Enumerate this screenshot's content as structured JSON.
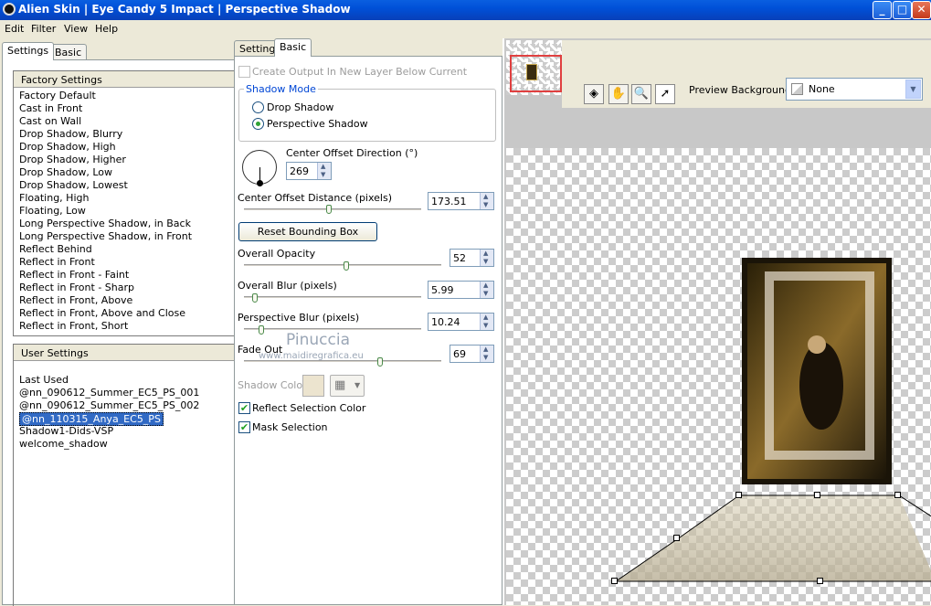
{
  "window": {
    "title": "Alien Skin | Eye Candy 5 Impact | Perspective Shadow",
    "min": "_",
    "max": "□",
    "close": "✕"
  },
  "menu": [
    "Edit",
    "Filter",
    "View",
    "Help"
  ],
  "left_tabs": [
    "Settings",
    "Basic"
  ],
  "factory": {
    "header": "Factory Settings",
    "items": [
      "Factory Default",
      "Cast in Front",
      "Cast on Wall",
      "Drop Shadow, Blurry",
      "Drop Shadow, High",
      "Drop Shadow, Higher",
      "Drop Shadow, Low",
      "Drop Shadow, Lowest",
      "Floating, High",
      "Floating, Low",
      "Long Perspective Shadow, in Back",
      "Long Perspective Shadow, in Front",
      "Reflect Behind",
      "Reflect in Front",
      "Reflect in Front - Faint",
      "Reflect in Front - Sharp",
      "Reflect in Front, Above",
      "Reflect in Front, Above and Close",
      "Reflect in Front, Short"
    ]
  },
  "user": {
    "header": "User Settings",
    "items": [
      "Last Used",
      "@nn_090612_Summer_EC5_PS_001",
      "@nn_090612_Summer_EC5_PS_002",
      "@nn_110315_Anya_EC5_PS",
      "Shadow1-Dids-VSP",
      "welcome_shadow"
    ],
    "selected_index": 3
  },
  "mid_tabs": [
    "Settings",
    "Basic"
  ],
  "basic": {
    "create_output": "Create Output In New Layer Below Current",
    "shadow_mode_label": "Shadow Mode",
    "modes": [
      "Drop Shadow",
      "Perspective Shadow"
    ],
    "selected_mode": 1,
    "direction_label": "Center Offset Direction (°)",
    "direction_value": "269",
    "distance_label": "Center Offset Distance (pixels)",
    "distance_value": "173.51",
    "reset_button": "Reset Bounding Box",
    "opacity_label": "Overall Opacity",
    "opacity_value": "52",
    "blur_label": "Overall Blur (pixels)",
    "blur_value": "5.99",
    "pblur_label": "Perspective Blur (pixels)",
    "pblur_value": "10.24",
    "fade_label": "Fade Out",
    "fade_value": "69",
    "shadow_color_label": "Shadow Color",
    "reflect_label": "Reflect Selection Color",
    "mask_label": "Mask Selection"
  },
  "slider_levels": {
    "distance": 0.48,
    "opacity": 0.52,
    "blur": 0.06,
    "pblur": 0.1,
    "fade": 0.69
  },
  "watermark": {
    "name": "Pinuccia",
    "url": "www.maidiregrafica.eu"
  },
  "preview": {
    "bg_label": "Preview Background:",
    "bg_value": "None"
  },
  "colors": {
    "title_bar": "#0050d8",
    "selection": "#316ac5",
    "shadow_swatch": "#ece4cf"
  }
}
